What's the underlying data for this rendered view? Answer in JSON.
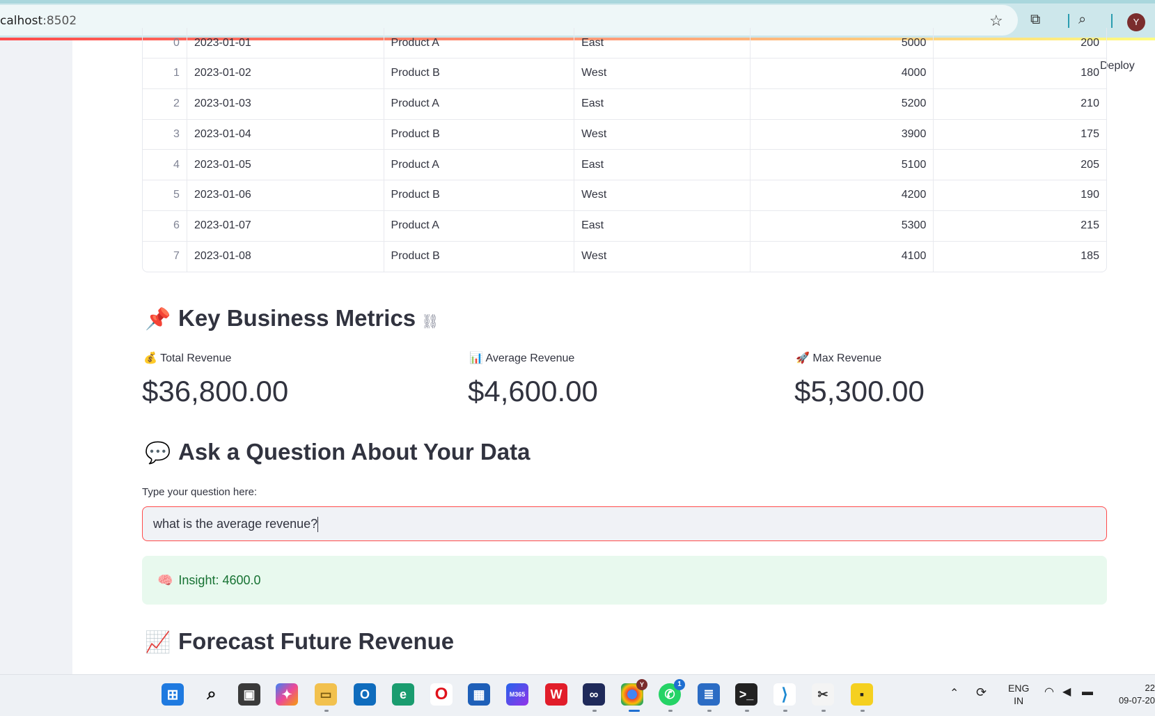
{
  "browser": {
    "url_host": "calhost",
    "url_port": ":8502",
    "avatar_initial": "Y"
  },
  "app": {
    "deploy_label": "Deploy"
  },
  "table": {
    "rows": [
      {
        "idx": "0",
        "date": "2023-01-01",
        "product": "Product A",
        "region": "East",
        "revenue": "5000",
        "units": "200"
      },
      {
        "idx": "1",
        "date": "2023-01-02",
        "product": "Product B",
        "region": "West",
        "revenue": "4000",
        "units": "180"
      },
      {
        "idx": "2",
        "date": "2023-01-03",
        "product": "Product A",
        "region": "East",
        "revenue": "5200",
        "units": "210"
      },
      {
        "idx": "3",
        "date": "2023-01-04",
        "product": "Product B",
        "region": "West",
        "revenue": "3900",
        "units": "175"
      },
      {
        "idx": "4",
        "date": "2023-01-05",
        "product": "Product A",
        "region": "East",
        "revenue": "5100",
        "units": "205"
      },
      {
        "idx": "5",
        "date": "2023-01-06",
        "product": "Product B",
        "region": "West",
        "revenue": "4200",
        "units": "190"
      },
      {
        "idx": "6",
        "date": "2023-01-07",
        "product": "Product A",
        "region": "East",
        "revenue": "5300",
        "units": "215"
      },
      {
        "idx": "7",
        "date": "2023-01-08",
        "product": "Product B",
        "region": "West",
        "revenue": "4100",
        "units": "185"
      }
    ]
  },
  "metrics_section": {
    "emoji": "📌",
    "title": "Key Business Metrics",
    "items": [
      {
        "emoji": "💰",
        "label": "Total Revenue",
        "value": "$36,800.00"
      },
      {
        "emoji": "📊",
        "label": "Average Revenue",
        "value": "$4,600.00"
      },
      {
        "emoji": "🚀",
        "label": "Max Revenue",
        "value": "$5,300.00"
      }
    ]
  },
  "question_section": {
    "emoji": "💬",
    "title": "Ask a Question About Your Data",
    "input_label": "Type your question here:",
    "input_value": "what is the average revenue?",
    "insight_emoji": "🧠",
    "insight_text": "Insight: 4600.0"
  },
  "forecast_section": {
    "emoji": "📈",
    "title": "Forecast Future Revenue"
  },
  "taskbar": {
    "language": "ENG",
    "region": "IN",
    "time": "22",
    "date": "09-07-20",
    "whatsapp_badge": "1",
    "chrome_badge": "Y",
    "m365_label": "M365"
  },
  "colors": {
    "accent": "#ff4b4b",
    "insight_bg": "#e8f9ee",
    "insight_text": "#177233",
    "sidebar": "#f0f2f6"
  }
}
